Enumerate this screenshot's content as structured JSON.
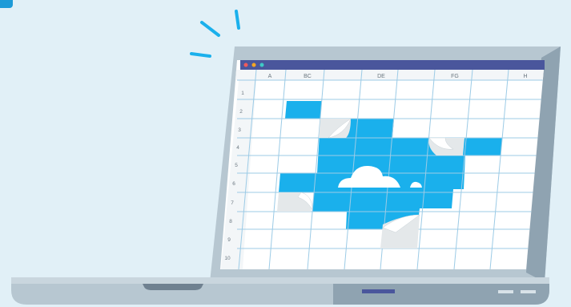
{
  "colors": {
    "background": "#e1f0f7",
    "accent_blue": "#1ab0ec",
    "laptop_frame": "#b7c7d1",
    "laptop_frame_dark": "#8fa3b1",
    "title_bar": "#4a569c",
    "grid_line": "#9ccbe6",
    "peel_gray": "#e4e8ea"
  },
  "window": {
    "controls": [
      "close-dot",
      "minimize-dot",
      "zoom-dot"
    ],
    "control_colors": [
      "#f15a5a",
      "#f5a623",
      "#3ec9c5"
    ]
  },
  "spreadsheet": {
    "column_headers": [
      "A",
      "BC",
      "",
      "DE",
      "",
      "FG",
      "",
      "H"
    ],
    "row_headers": [
      "1",
      "2",
      "3",
      "4",
      "5",
      "6",
      "7",
      "8",
      "9",
      "10"
    ]
  },
  "icons": {
    "cloud": "cloud-icon",
    "sparkle": "sparkle-lines-icon"
  }
}
